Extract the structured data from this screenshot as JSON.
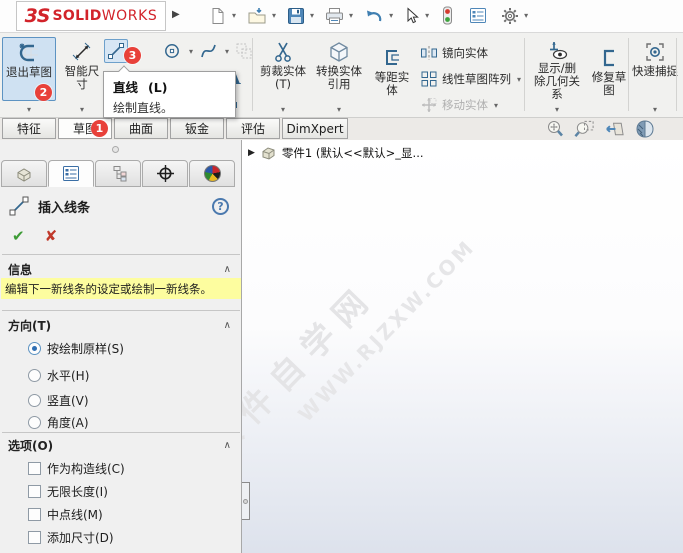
{
  "titlebar": {
    "brand_mark": "3S",
    "brand_bold": "SOLID",
    "brand_light": "WORKS",
    "quick_access": [
      "new-document",
      "open-folder",
      "save",
      "print",
      "undo",
      "select-cursor",
      "rebuild-traffic-light",
      "options-list",
      "settings-gear"
    ]
  },
  "ribbon": {
    "exit_sketch": {
      "label": "退出草图",
      "badge": "2"
    },
    "smart_dimension": {
      "label": "智能尺寸"
    },
    "entity_tools": {
      "line_badge": "3",
      "icons": [
        "line",
        "circle",
        "spline",
        "pattern",
        "rectangle",
        "arc",
        "text",
        "ellipse",
        "point"
      ]
    },
    "trim": {
      "label": "剪裁实体(T)"
    },
    "convert": {
      "label": "转换实体引用"
    },
    "offset": {
      "label": "等距实体"
    },
    "mirror": {
      "label": "镜向实体"
    },
    "linear_pattern": {
      "label": "线性草图阵列"
    },
    "move": {
      "label": "移动实体",
      "disabled": true
    },
    "display_relations": {
      "label": "显示/删除几何关系"
    },
    "repair_sketch": {
      "label": "修复草图"
    },
    "quick_snaps": {
      "label": "快速捕捉"
    }
  },
  "tooltip": {
    "title": "直线",
    "shortcut": "(L)",
    "description": "绘制直线。"
  },
  "step_badges": {
    "one": "1",
    "two": "2",
    "three": "3"
  },
  "tabbar": {
    "tabs": [
      {
        "label": "特征",
        "active": false
      },
      {
        "label": "草图",
        "active": true,
        "badge": "1"
      },
      {
        "label": "曲面",
        "active": false
      },
      {
        "label": "钣金",
        "active": false
      },
      {
        "label": "评估",
        "active": false
      },
      {
        "label": "DimXpert",
        "active": false
      }
    ],
    "view_tools": [
      "zoom-to-fit",
      "zoom-to-area",
      "previous-view",
      "section-view"
    ]
  },
  "panel": {
    "manager_tabs": [
      "feature-manager",
      "property-manager",
      "configuration-manager",
      "dimxpert-manager",
      "display-manager"
    ],
    "active_manager_tab": "property-manager",
    "title": "插入线条",
    "sections": {
      "message": {
        "header": "信息",
        "text": "编辑下一新线条的设定或绘制一新线条。"
      },
      "orientation": {
        "header": "方向(T)",
        "options": [
          {
            "label": "按绘制原样(S)",
            "selected": true
          },
          {
            "label": "水平(H)",
            "selected": false
          },
          {
            "label": "竖直(V)",
            "selected": false
          },
          {
            "label": "角度(A)",
            "selected": false
          }
        ]
      },
      "options": {
        "header": "选项(O)",
        "items": [
          {
            "label": "作为构造线(C)",
            "checked": false
          },
          {
            "label": "无限长度(I)",
            "checked": false
          },
          {
            "label": "中点线(M)",
            "checked": false
          },
          {
            "label": "添加尺寸(D)",
            "checked": false
          }
        ]
      }
    }
  },
  "viewport": {
    "tree_item": "零件1 (默认<<默认>_显...",
    "watermark_line1": "软件自学网",
    "watermark_line2": "WWW.RJZXW.COM"
  },
  "colors": {
    "badge_red": "#e8413a",
    "solidworks_red": "#d2232a",
    "selection_blue": "#6da0cb",
    "icon_blue": "#33678f",
    "message_highlight": "#fdfd9f"
  }
}
